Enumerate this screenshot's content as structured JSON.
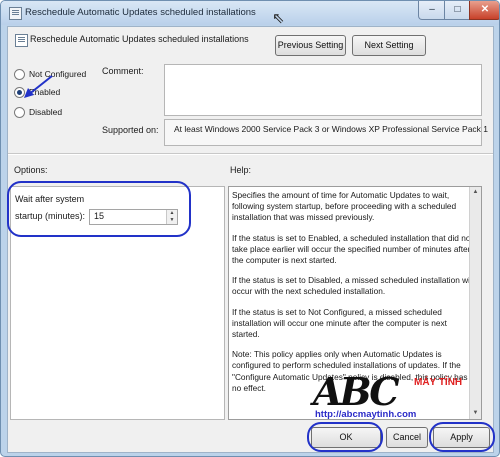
{
  "window": {
    "title": "Reschedule Automatic Updates scheduled installations",
    "controls": {
      "minimize": "–",
      "maximize": "□",
      "close": "✕"
    }
  },
  "header": {
    "policy_name": "Reschedule Automatic Updates scheduled installations",
    "previous_label": "Previous Setting",
    "next_label": "Next Setting"
  },
  "state": {
    "options": [
      "Not Configured",
      "Enabled",
      "Disabled"
    ],
    "selected": "Enabled"
  },
  "comment": {
    "label": "Comment:",
    "value": ""
  },
  "supported": {
    "label": "Supported on:",
    "value": "At least Windows 2000 Service Pack 3 or Windows XP Professional Service Pack 1"
  },
  "options_panel": {
    "label": "Options:",
    "wait_label_line1": "Wait after system",
    "wait_label_line2": "startup (minutes):",
    "wait_value": "15"
  },
  "help_panel": {
    "label": "Help:",
    "paragraphs": [
      "Specifies the amount of time for Automatic Updates to wait, following system startup, before proceeding with a scheduled installation that was missed previously.",
      "If the status is set to Enabled, a scheduled installation that did not take place earlier will occur the specified number of minutes after the computer is next started.",
      "If the status is set to Disabled, a missed scheduled installation will occur with the next scheduled installation.",
      "If the status is set to Not Configured, a missed scheduled installation will occur one minute after the computer is next started.",
      "Note: This policy applies only when Automatic Updates is configured to perform scheduled installations of updates. If the \"Configure Automatic Updates\" policy is disabled, this policy has no effect."
    ]
  },
  "footer": {
    "ok": "OK",
    "cancel": "Cancel",
    "apply": "Apply"
  },
  "watermark": {
    "logo_text": "ABC",
    "brand": "MÁY TÍNH",
    "url": "http://abcmaytinh.com"
  },
  "colors": {
    "annotation": "#2232c8",
    "brand_red": "#e02020",
    "title_bar": "#bcd3ea"
  }
}
